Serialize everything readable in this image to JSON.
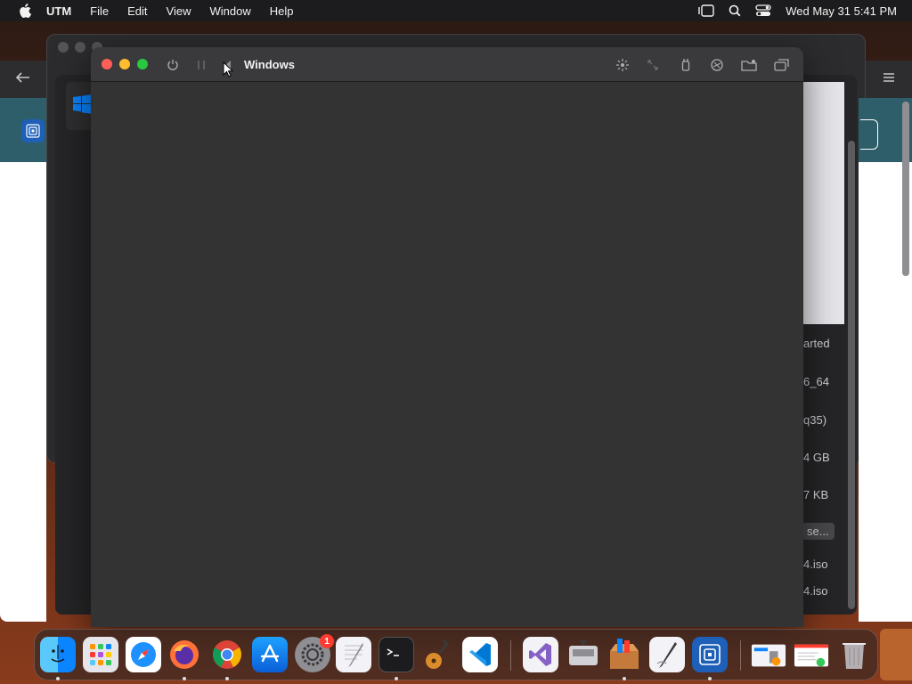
{
  "menubar": {
    "app_name": "UTM",
    "items": [
      "File",
      "Edit",
      "View",
      "Window",
      "Help"
    ],
    "clock": "Wed May 31  5:41 PM",
    "icons": [
      "stage-manager-icon",
      "spotlight-search-icon",
      "control-center-icon"
    ]
  },
  "vm_window": {
    "title": "Windows",
    "toolbar_icons": [
      "power-icon",
      "pause-icon",
      "back-icon",
      "display-icon",
      "resize-icon",
      "usb-icon",
      "drive-icon",
      "shared-folder-icon",
      "windows-icon"
    ],
    "traffic_colors": {
      "close": "#ff5f57",
      "minimize": "#febc2e",
      "maximize": "#28c840"
    }
  },
  "vm_details": {
    "status": "arted",
    "architecture": "6_64",
    "machine": "q35)",
    "memory": "4 GB",
    "size": "7 KB",
    "browse_button": "se...",
    "cd_1": "4.iso",
    "cd_2": "4.iso"
  },
  "dock": {
    "apps": [
      {
        "name": "Finder",
        "icon": "finder-icon",
        "running": true
      },
      {
        "name": "Launchpad",
        "icon": "launchpad-icon",
        "running": false
      },
      {
        "name": "Safari",
        "icon": "safari-icon",
        "running": false
      },
      {
        "name": "Firefox",
        "icon": "firefox-icon",
        "running": true
      },
      {
        "name": "Chrome",
        "icon": "chrome-icon",
        "running": true
      },
      {
        "name": "App Store",
        "icon": "app-store-icon",
        "running": false
      },
      {
        "name": "System Settings",
        "icon": "system-settings-icon",
        "running": false,
        "badge": "1"
      },
      {
        "name": "TextEdit",
        "icon": "textedit-icon",
        "running": false
      },
      {
        "name": "Terminal",
        "icon": "terminal-icon",
        "running": true
      },
      {
        "name": "GarageBand",
        "icon": "garageband-icon",
        "running": false
      },
      {
        "name": "Visual Studio Code",
        "icon": "vscode-icon",
        "running": false
      },
      {
        "name": "Visual Studio",
        "icon": "visual-studio-icon",
        "running": false
      },
      {
        "name": "Boot Camp Assistant",
        "icon": "bootcamp-icon",
        "running": false
      },
      {
        "name": "Archive Utility",
        "icon": "archive-icon",
        "running": true
      },
      {
        "name": "Script Editor",
        "icon": "script-editor-icon",
        "running": false
      },
      {
        "name": "UTM",
        "icon": "utm-icon",
        "running": true
      }
    ],
    "stacks": [
      "downloads-stack-icon",
      "documents-stack-icon",
      "trash-icon"
    ]
  }
}
